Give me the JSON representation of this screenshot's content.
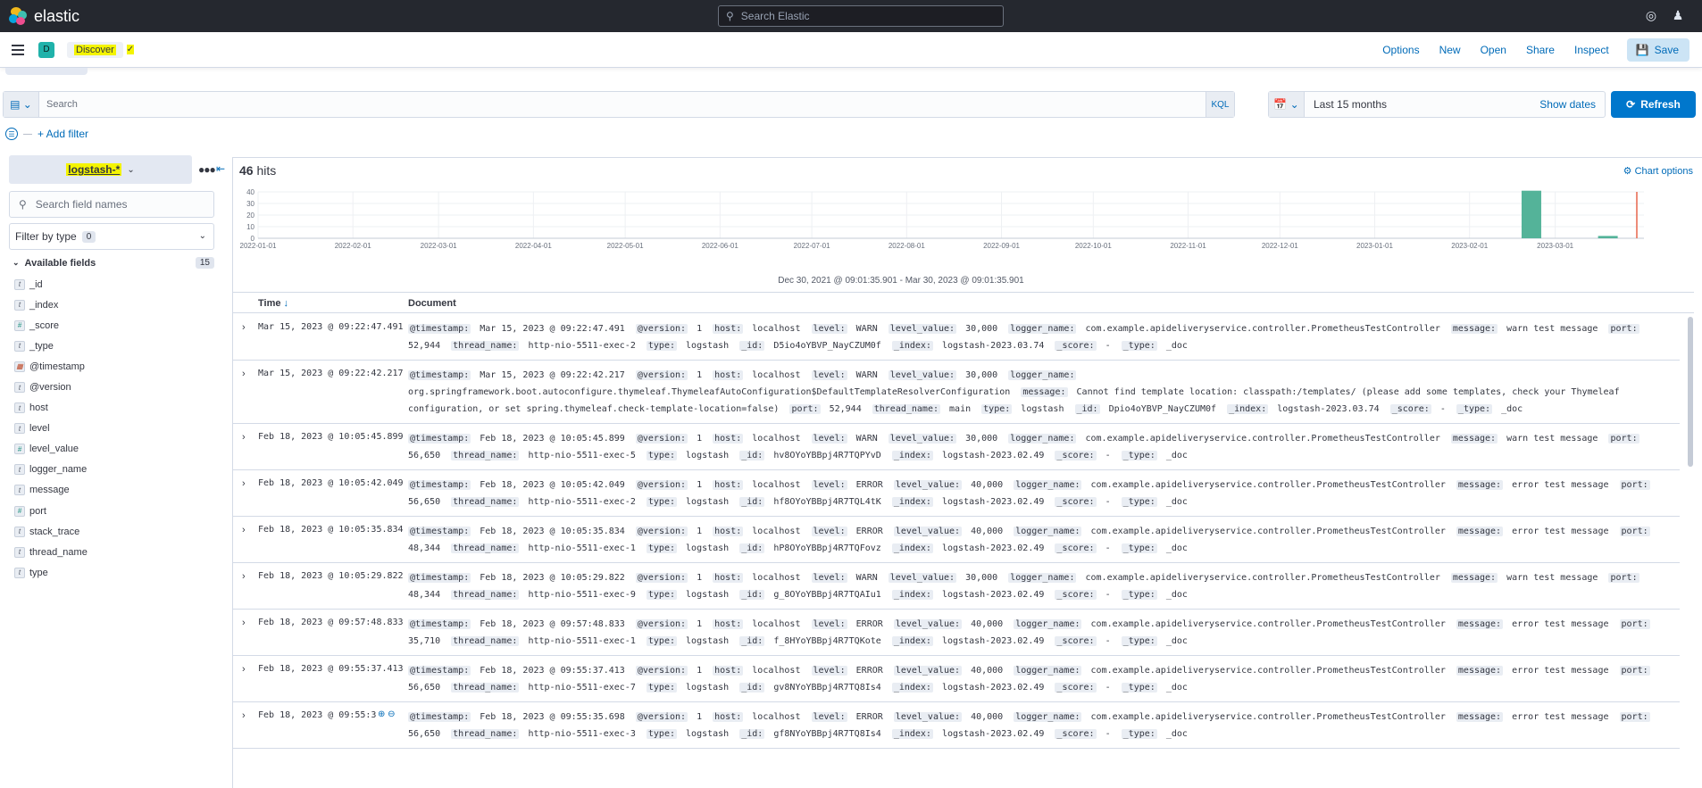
{
  "topbar": {
    "brand": "elastic",
    "search_placeholder": "Search Elastic"
  },
  "appbar": {
    "space_initial": "D",
    "breadcrumb": "Discover",
    "links": [
      "Options",
      "New",
      "Open",
      "Share",
      "Inspect"
    ],
    "save_label": "Save"
  },
  "query": {
    "placeholder": "Search",
    "language": "KQL",
    "date_range": "Last 15 months",
    "show_dates": "Show dates",
    "refresh": "Refresh",
    "add_filter": "+ Add filter"
  },
  "sidebar": {
    "index_pattern": "logstash-*",
    "field_search_placeholder": "Search field names",
    "filter_by_type": "Filter by type",
    "filter_count": "0",
    "available_label": "Available fields",
    "available_count": "15",
    "fields": [
      {
        "type": "t",
        "name": "_id"
      },
      {
        "type": "t",
        "name": "_index"
      },
      {
        "type": "#",
        "name": "_score"
      },
      {
        "type": "t",
        "name": "_type"
      },
      {
        "type": "cal",
        "name": "@timestamp"
      },
      {
        "type": "t",
        "name": "@version"
      },
      {
        "type": "t",
        "name": "host"
      },
      {
        "type": "t",
        "name": "level"
      },
      {
        "type": "#",
        "name": "level_value"
      },
      {
        "type": "t",
        "name": "logger_name"
      },
      {
        "type": "t",
        "name": "message"
      },
      {
        "type": "#",
        "name": "port"
      },
      {
        "type": "t",
        "name": "stack_trace"
      },
      {
        "type": "t",
        "name": "thread_name"
      },
      {
        "type": "t",
        "name": "type"
      }
    ]
  },
  "results": {
    "hits_count": "46",
    "hits_label": "hits",
    "chart_options": "Chart options",
    "range_label": "Dec 30, 2021 @ 09:01:35.901 - Mar 30, 2023 @ 09:01:35.901",
    "columns": {
      "time": "Time",
      "document": "Document"
    }
  },
  "chart_data": {
    "type": "bar",
    "y_ticks": [
      "40",
      "30",
      "20",
      "10",
      "0"
    ],
    "ylim": [
      0,
      40
    ],
    "x_ticks": [
      "2022-01-01",
      "2022-02-01",
      "2022-03-01",
      "2022-04-01",
      "2022-05-01",
      "2022-06-01",
      "2022-07-01",
      "2022-08-01",
      "2022-09-01",
      "2022-10-01",
      "2022-11-01",
      "2022-12-01",
      "2023-01-01",
      "2023-02-01",
      "2023-03-01"
    ],
    "bars": [
      {
        "period": "2023-02-18",
        "value": 41
      },
      {
        "period": "2023-03-15",
        "value": 2
      }
    ],
    "bar_color": "#54b399",
    "now_marker_color": "#e7664c"
  },
  "rows": [
    {
      "time": "Mar 15, 2023 @ 09:22:47.491",
      "fields": [
        [
          "@timestamp:",
          "Mar 15, 2023 @ 09:22:47.491"
        ],
        [
          "@version:",
          "1"
        ],
        [
          "host:",
          "localhost"
        ],
        [
          "level:",
          "WARN"
        ],
        [
          "level_value:",
          "30,000"
        ],
        [
          "logger_name:",
          "com.example.apideliveryservice.controller.PrometheusTestController"
        ],
        [
          "message:",
          "warn test message"
        ],
        [
          "port:",
          "52,944"
        ],
        [
          "thread_name:",
          "http-nio-5511-exec-2"
        ],
        [
          "type:",
          "logstash"
        ],
        [
          "_id:",
          "D5io4oYBVP_NayCZUM0f"
        ],
        [
          "_index:",
          "logstash-2023.03.74"
        ],
        [
          "_score:",
          " - "
        ],
        [
          "_type:",
          "_doc"
        ]
      ]
    },
    {
      "time": "Mar 15, 2023 @ 09:22:42.217",
      "fields": [
        [
          "@timestamp:",
          "Mar 15, 2023 @ 09:22:42.217"
        ],
        [
          "@version:",
          "1"
        ],
        [
          "host:",
          "localhost"
        ],
        [
          "level:",
          "WARN"
        ],
        [
          "level_value:",
          "30,000"
        ],
        [
          "logger_name:",
          "org.springframework.boot.autoconfigure.thymeleaf.ThymeleafAutoConfiguration$DefaultTemplateResolverConfiguration"
        ],
        [
          "message:",
          "Cannot find template location: classpath:/templates/ (please add some templates, check your Thymeleaf configuration, or set spring.thymeleaf.check-template-location=false)"
        ],
        [
          "port:",
          "52,944"
        ],
        [
          "thread_name:",
          "main"
        ],
        [
          "type:",
          "logstash"
        ],
        [
          "_id:",
          "Dpio4oYBVP_NayCZUM0f"
        ],
        [
          "_index:",
          "logstash-2023.03.74"
        ],
        [
          "_score:",
          " - "
        ],
        [
          "_type:",
          "_doc"
        ]
      ]
    },
    {
      "time": "Feb 18, 2023 @ 10:05:45.899",
      "fields": [
        [
          "@timestamp:",
          "Feb 18, 2023 @ 10:05:45.899"
        ],
        [
          "@version:",
          "1"
        ],
        [
          "host:",
          "localhost"
        ],
        [
          "level:",
          "WARN"
        ],
        [
          "level_value:",
          "30,000"
        ],
        [
          "logger_name:",
          "com.example.apideliveryservice.controller.PrometheusTestController"
        ],
        [
          "message:",
          "warn test message"
        ],
        [
          "port:",
          "56,650"
        ],
        [
          "thread_name:",
          "http-nio-5511-exec-5"
        ],
        [
          "type:",
          "logstash"
        ],
        [
          "_id:",
          "hv8OYoYBBpj4R7TQPYvD"
        ],
        [
          "_index:",
          "logstash-2023.02.49"
        ],
        [
          "_score:",
          " - "
        ],
        [
          "_type:",
          "_doc"
        ]
      ]
    },
    {
      "time": "Feb 18, 2023 @ 10:05:42.049",
      "fields": [
        [
          "@timestamp:",
          "Feb 18, 2023 @ 10:05:42.049"
        ],
        [
          "@version:",
          "1"
        ],
        [
          "host:",
          "localhost"
        ],
        [
          "level:",
          "ERROR"
        ],
        [
          "level_value:",
          "40,000"
        ],
        [
          "logger_name:",
          "com.example.apideliveryservice.controller.PrometheusTestController"
        ],
        [
          "message:",
          "error test message"
        ],
        [
          "port:",
          "56,650"
        ],
        [
          "thread_name:",
          "http-nio-5511-exec-2"
        ],
        [
          "type:",
          "logstash"
        ],
        [
          "_id:",
          "hf8OYoYBBpj4R7TQL4tK"
        ],
        [
          "_index:",
          "logstash-2023.02.49"
        ],
        [
          "_score:",
          " - "
        ],
        [
          "_type:",
          "_doc"
        ]
      ]
    },
    {
      "time": "Feb 18, 2023 @ 10:05:35.834",
      "fields": [
        [
          "@timestamp:",
          "Feb 18, 2023 @ 10:05:35.834"
        ],
        [
          "@version:",
          "1"
        ],
        [
          "host:",
          "localhost"
        ],
        [
          "level:",
          "ERROR"
        ],
        [
          "level_value:",
          "40,000"
        ],
        [
          "logger_name:",
          "com.example.apideliveryservice.controller.PrometheusTestController"
        ],
        [
          "message:",
          "error test message"
        ],
        [
          "port:",
          "48,344"
        ],
        [
          "thread_name:",
          "http-nio-5511-exec-1"
        ],
        [
          "type:",
          "logstash"
        ],
        [
          "_id:",
          "hP8OYoYBBpj4R7TQFovz"
        ],
        [
          "_index:",
          "logstash-2023.02.49"
        ],
        [
          "_score:",
          " - "
        ],
        [
          "_type:",
          "_doc"
        ]
      ]
    },
    {
      "time": "Feb 18, 2023 @ 10:05:29.822",
      "fields": [
        [
          "@timestamp:",
          "Feb 18, 2023 @ 10:05:29.822"
        ],
        [
          "@version:",
          "1"
        ],
        [
          "host:",
          "localhost"
        ],
        [
          "level:",
          "WARN"
        ],
        [
          "level_value:",
          "30,000"
        ],
        [
          "logger_name:",
          "com.example.apideliveryservice.controller.PrometheusTestController"
        ],
        [
          "message:",
          "warn test message"
        ],
        [
          "port:",
          "48,344"
        ],
        [
          "thread_name:",
          "http-nio-5511-exec-9"
        ],
        [
          "type:",
          "logstash"
        ],
        [
          "_id:",
          "g_8OYoYBBpj4R7TQAIu1"
        ],
        [
          "_index:",
          "logstash-2023.02.49"
        ],
        [
          "_score:",
          " - "
        ],
        [
          "_type:",
          "_doc"
        ]
      ]
    },
    {
      "time": "Feb 18, 2023 @ 09:57:48.833",
      "fields": [
        [
          "@timestamp:",
          "Feb 18, 2023 @ 09:57:48.833"
        ],
        [
          "@version:",
          "1"
        ],
        [
          "host:",
          "localhost"
        ],
        [
          "level:",
          "ERROR"
        ],
        [
          "level_value:",
          "40,000"
        ],
        [
          "logger_name:",
          "com.example.apideliveryservice.controller.PrometheusTestController"
        ],
        [
          "message:",
          "error test message"
        ],
        [
          "port:",
          "35,710"
        ],
        [
          "thread_name:",
          "http-nio-5511-exec-1"
        ],
        [
          "type:",
          "logstash"
        ],
        [
          "_id:",
          "f_8HYoYBBpj4R7TQKote"
        ],
        [
          "_index:",
          "logstash-2023.02.49"
        ],
        [
          "_score:",
          " - "
        ],
        [
          "_type:",
          "_doc"
        ]
      ]
    },
    {
      "time": "Feb 18, 2023 @ 09:55:37.413",
      "fields": [
        [
          "@timestamp:",
          "Feb 18, 2023 @ 09:55:37.413"
        ],
        [
          "@version:",
          "1"
        ],
        [
          "host:",
          "localhost"
        ],
        [
          "level:",
          "ERROR"
        ],
        [
          "level_value:",
          "40,000"
        ],
        [
          "logger_name:",
          "com.example.apideliveryservice.controller.PrometheusTestController"
        ],
        [
          "message:",
          "error test message"
        ],
        [
          "port:",
          "56,650"
        ],
        [
          "thread_name:",
          "http-nio-5511-exec-7"
        ],
        [
          "type:",
          "logstash"
        ],
        [
          "_id:",
          "gv8NYoYBBpj4R7TQ8Is4"
        ],
        [
          "_index:",
          "logstash-2023.02.49"
        ],
        [
          "_score:",
          " - "
        ],
        [
          "_type:",
          "_doc"
        ]
      ]
    },
    {
      "time": "Feb 18, 2023 @ 09:55:3",
      "fields": [
        [
          "@timestamp:",
          "Feb 18, 2023 @ 09:55:35.698"
        ],
        [
          "@version:",
          "1"
        ],
        [
          "host:",
          "localhost"
        ],
        [
          "level:",
          "ERROR"
        ],
        [
          "level_value:",
          "40,000"
        ],
        [
          "logger_name:",
          "com.example.apideliveryservice.controller.PrometheusTestController"
        ],
        [
          "message:",
          "error test message"
        ],
        [
          "port:",
          "56,650"
        ],
        [
          "thread_name:",
          "http-nio-5511-exec-3"
        ],
        [
          "type:",
          "logstash"
        ],
        [
          "_id:",
          "gf8NYoYBBpj4R7TQ8Is4"
        ],
        [
          "_index:",
          "logstash-2023.02.49"
        ],
        [
          "_score:",
          " - "
        ],
        [
          "_type:",
          "_doc"
        ]
      ]
    }
  ]
}
